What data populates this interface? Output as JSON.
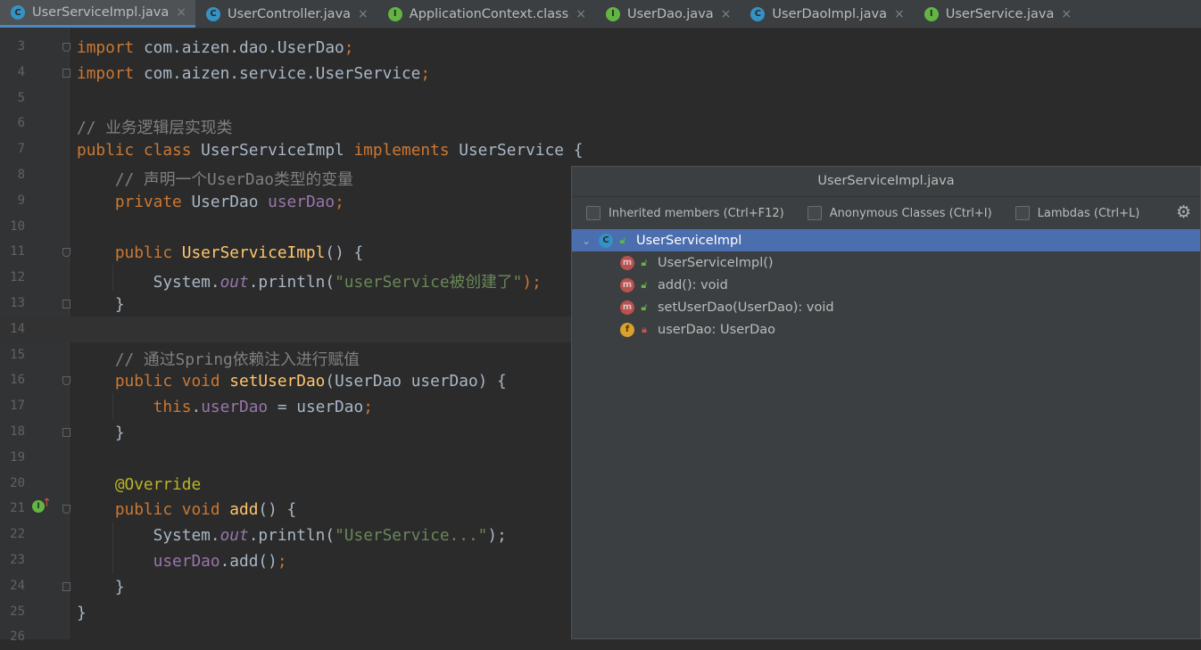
{
  "tabs": [
    {
      "label": "UserServiceImpl.java",
      "kind": "class",
      "icon": "C",
      "closable": true,
      "active": true
    },
    {
      "label": "UserController.java",
      "kind": "class",
      "icon": "C",
      "closable": true,
      "active": false
    },
    {
      "label": "ApplicationContext.class",
      "kind": "iface",
      "icon": "I",
      "closable": true,
      "active": false
    },
    {
      "label": "UserDao.java",
      "kind": "iface",
      "icon": "I",
      "closable": true,
      "active": false
    },
    {
      "label": "UserDaoImpl.java",
      "kind": "class",
      "icon": "C",
      "closable": true,
      "active": false
    },
    {
      "label": "UserService.java",
      "kind": "iface",
      "icon": "I",
      "closable": true,
      "active": false
    }
  ],
  "close_glyph": "×",
  "editor": {
    "current_line": 14,
    "lines": [
      {
        "num": "3",
        "fold": "open",
        "tokens": [
          {
            "t": "import",
            "c": "kw"
          },
          {
            "t": " com.aizen.dao.UserDao",
            "c": ""
          },
          {
            "t": ";",
            "c": "kw"
          }
        ]
      },
      {
        "num": "4",
        "fold": "close",
        "tokens": [
          {
            "t": "import",
            "c": "kw"
          },
          {
            "t": " com.aizen.service.UserService",
            "c": ""
          },
          {
            "t": ";",
            "c": "kw"
          }
        ]
      },
      {
        "num": "5",
        "tokens": []
      },
      {
        "num": "6",
        "tokens": [
          {
            "t": "// 业务逻辑层实现类",
            "c": "cm"
          }
        ]
      },
      {
        "num": "7",
        "tokens": [
          {
            "t": "public class ",
            "c": "kw"
          },
          {
            "t": "UserServiceImpl ",
            "c": ""
          },
          {
            "t": "implements ",
            "c": "kw"
          },
          {
            "t": "UserService {",
            "c": ""
          }
        ]
      },
      {
        "num": "8",
        "tokens": [
          {
            "t": "    // 声明一个UserDao类型的变量",
            "c": "cm"
          }
        ]
      },
      {
        "num": "9",
        "tokens": [
          {
            "t": "    private ",
            "c": "kw"
          },
          {
            "t": "UserDao ",
            "c": ""
          },
          {
            "t": "userDao",
            "c": "fld"
          },
          {
            "t": ";",
            "c": "kw"
          }
        ]
      },
      {
        "num": "10",
        "tokens": []
      },
      {
        "num": "11",
        "fold": "open",
        "tokens": [
          {
            "t": "    public ",
            "c": "kw"
          },
          {
            "t": "UserServiceImpl",
            "c": "fn"
          },
          {
            "t": "() {",
            "c": ""
          }
        ]
      },
      {
        "num": "12",
        "guide": true,
        "tokens": [
          {
            "t": "        System.",
            "c": ""
          },
          {
            "t": "out",
            "c": "st"
          },
          {
            "t": ".println(",
            "c": ""
          },
          {
            "t": "\"userService被创建了\"",
            "c": "str"
          },
          {
            "t": ");",
            "c": "kw"
          }
        ]
      },
      {
        "num": "13",
        "fold": "close",
        "tokens": [
          {
            "t": "    }",
            "c": ""
          }
        ]
      },
      {
        "num": "14",
        "tokens": []
      },
      {
        "num": "15",
        "tokens": [
          {
            "t": "    // 通过Spring依赖注入进行赋值",
            "c": "cm"
          }
        ]
      },
      {
        "num": "16",
        "fold": "open",
        "tokens": [
          {
            "t": "    public void ",
            "c": "kw"
          },
          {
            "t": "setUserDao",
            "c": "fn"
          },
          {
            "t": "(UserDao userDao) {",
            "c": ""
          }
        ]
      },
      {
        "num": "17",
        "guide": true,
        "tokens": [
          {
            "t": "        this",
            "c": "kw"
          },
          {
            "t": ".",
            "c": ""
          },
          {
            "t": "userDao",
            "c": "fld"
          },
          {
            "t": " = userDao",
            "c": ""
          },
          {
            "t": ";",
            "c": "kw"
          }
        ]
      },
      {
        "num": "18",
        "fold": "close",
        "tokens": [
          {
            "t": "    }",
            "c": ""
          }
        ]
      },
      {
        "num": "19",
        "tokens": []
      },
      {
        "num": "20",
        "tokens": [
          {
            "t": "    @Override",
            "c": "ann"
          }
        ]
      },
      {
        "num": "21",
        "fold": "open",
        "marker": "I",
        "tokens": [
          {
            "t": "    public void ",
            "c": "kw"
          },
          {
            "t": "add",
            "c": "fn"
          },
          {
            "t": "() {",
            "c": ""
          }
        ]
      },
      {
        "num": "22",
        "guide": true,
        "tokens": [
          {
            "t": "        System.",
            "c": ""
          },
          {
            "t": "out",
            "c": "st"
          },
          {
            "t": ".println(",
            "c": ""
          },
          {
            "t": "\"UserService...\"",
            "c": "str"
          },
          {
            "t": ");",
            "c": ""
          }
        ]
      },
      {
        "num": "23",
        "guide": true,
        "tokens": [
          {
            "t": "        userDao",
            "c": "fld"
          },
          {
            "t": ".add()",
            "c": ""
          },
          {
            "t": ";",
            "c": "kw"
          }
        ]
      },
      {
        "num": "24",
        "fold": "close",
        "tokens": [
          {
            "t": "    }",
            "c": ""
          }
        ]
      },
      {
        "num": "25",
        "tokens": [
          {
            "t": "}",
            "c": ""
          }
        ]
      },
      {
        "num": "26",
        "tokens": []
      }
    ]
  },
  "structure_popup": {
    "title": "UserServiceImpl.java",
    "options": [
      {
        "label": "Inherited members (Ctrl+F12)",
        "checked": false
      },
      {
        "label": "Anonymous Classes (Ctrl+I)",
        "checked": false
      },
      {
        "label": "Lambdas (Ctrl+L)",
        "checked": false
      }
    ],
    "settings_icon": "gear-icon",
    "tree": [
      {
        "label": "UserServiceImpl",
        "icon": "C",
        "kind": "class",
        "visibility": "public",
        "selected": true,
        "expanded": true,
        "depth": 0
      },
      {
        "label": "UserServiceImpl()",
        "icon": "m",
        "kind": "method",
        "visibility": "public",
        "selected": false,
        "depth": 1
      },
      {
        "label": "add(): void",
        "icon": "m",
        "kind": "method",
        "visibility": "public",
        "selected": false,
        "depth": 1
      },
      {
        "label": "setUserDao(UserDao): void",
        "icon": "m",
        "kind": "method",
        "visibility": "public",
        "selected": false,
        "depth": 1
      },
      {
        "label": "userDao: UserDao",
        "icon": "f",
        "kind": "field",
        "visibility": "private",
        "selected": false,
        "depth": 1
      }
    ]
  },
  "colors": {
    "background": "#2b2b2b",
    "keyword": "#cc7832",
    "comment": "#808080",
    "function": "#ffc66d",
    "field": "#9876aa",
    "string": "#6a8759",
    "annotation": "#bbb529",
    "selection": "#4b6eaf"
  }
}
